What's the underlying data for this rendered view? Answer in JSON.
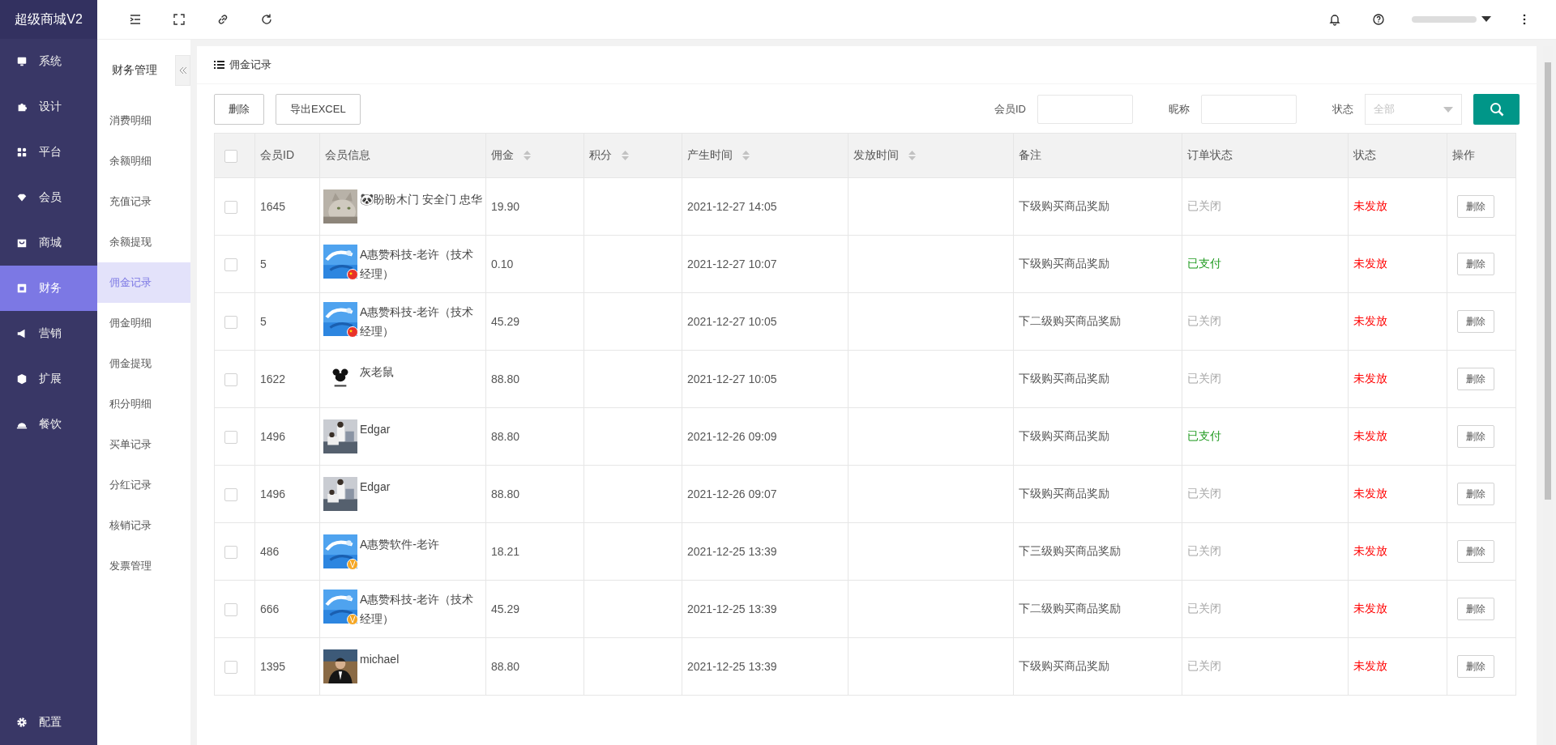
{
  "app": {
    "title": "超级商城V2"
  },
  "nav": [
    {
      "label": "系统",
      "selected": false
    },
    {
      "label": "设计",
      "selected": false
    },
    {
      "label": "平台",
      "selected": false
    },
    {
      "label": "会员",
      "selected": false
    },
    {
      "label": "商城",
      "selected": false
    },
    {
      "label": "财务",
      "selected": true
    },
    {
      "label": "营销",
      "selected": false
    },
    {
      "label": "扩展",
      "selected": false
    },
    {
      "label": "餐饮",
      "selected": false
    }
  ],
  "nav_bottom": {
    "label": "配置"
  },
  "subnav": {
    "title": "财务管理",
    "items": [
      {
        "label": "消费明细",
        "selected": false
      },
      {
        "label": "余额明细",
        "selected": false
      },
      {
        "label": "充值记录",
        "selected": false
      },
      {
        "label": "余额提现",
        "selected": false
      },
      {
        "label": "佣金记录",
        "selected": true
      },
      {
        "label": "佣金明细",
        "selected": false
      },
      {
        "label": "佣金提现",
        "selected": false
      },
      {
        "label": "积分明细",
        "selected": false
      },
      {
        "label": "买单记录",
        "selected": false
      },
      {
        "label": "分红记录",
        "selected": false
      },
      {
        "label": "核销记录",
        "selected": false
      },
      {
        "label": "发票管理",
        "selected": false
      }
    ]
  },
  "card": {
    "title": "佣金记录"
  },
  "toolbar": {
    "buttons": [
      "删除",
      "导出EXCEL"
    ],
    "filters": [
      {
        "label": "会员ID",
        "kind": "input"
      },
      {
        "label": "昵称",
        "kind": "input"
      },
      {
        "label": "状态",
        "kind": "select",
        "value": "全部"
      }
    ]
  },
  "table": {
    "all_checked": false,
    "columns": [
      {
        "label": "会员ID",
        "sortable": false
      },
      {
        "label": "会员信息",
        "sortable": false
      },
      {
        "label": "佣金",
        "sortable": true
      },
      {
        "label": "积分",
        "sortable": true
      },
      {
        "label": "产生时间",
        "sortable": true
      },
      {
        "label": "发放时间",
        "sortable": true
      },
      {
        "label": "备注",
        "sortable": false
      },
      {
        "label": "订单状态",
        "sortable": false
      },
      {
        "label": "状态",
        "sortable": false
      },
      {
        "label": "操作",
        "sortable": false
      }
    ],
    "rows": [
      {
        "checked": false,
        "member_id": "1645",
        "emoji": "🐼",
        "name": "盼盼木门 安全门 忠华",
        "commission": "19.90",
        "created": "2021-12-27 14:05",
        "remark": "下级购买商品奖励",
        "order_status": {
          "text": "已关闭",
          "kind": "closed"
        },
        "status": "未发放",
        "action": "删除"
      },
      {
        "checked": false,
        "member_id": "5",
        "avatar": {
          "kind": "picture",
          "badge": {
            "kind": "flag"
          }
        },
        "name": "A惠赞科技-老许（技术经理）",
        "commission": "0.10",
        "created": "2021-12-27 10:07",
        "remark": "下级购买商品奖励",
        "order_status": {
          "text": "已支付",
          "kind": "paid"
        },
        "status": "未发放",
        "action": "删除"
      },
      {
        "checked": false,
        "member_id": "5",
        "avatar": {
          "kind": "picture",
          "badge": {
            "kind": "flag"
          }
        },
        "name": "A惠赞科技-老许（技术经理）",
        "commission": "45.29",
        "created": "2021-12-27 10:05",
        "remark": "下二级购买商品奖励",
        "order_status": {
          "text": "已关闭",
          "kind": "closed"
        },
        "status": "未发放",
        "action": "删除"
      },
      {
        "checked": false,
        "member_id": "1622",
        "name": "灰老鼠",
        "commission": "88.80",
        "created": "2021-12-27 10:05",
        "remark": "下级购买商品奖励",
        "order_status": {
          "text": "已关闭",
          "kind": "closed"
        },
        "status": "未发放",
        "action": "删除"
      },
      {
        "checked": false,
        "member_id": "1496",
        "name": "Edgar",
        "commission": "88.80",
        "created": "2021-12-26 09:09",
        "remark": "下级购买商品奖励",
        "order_status": {
          "text": "已支付",
          "kind": "paid"
        },
        "status": "未发放",
        "action": "删除"
      },
      {
        "checked": false,
        "member_id": "1496",
        "name": "Edgar",
        "commission": "88.80",
        "created": "2021-12-26 09:07",
        "remark": "下级购买商品奖励",
        "order_status": {
          "text": "已关闭",
          "kind": "closed"
        },
        "status": "未发放",
        "action": "删除"
      },
      {
        "checked": false,
        "member_id": "486",
        "avatar": {
          "kind": "picture",
          "badge": {
            "kind": "vip",
            "text": "V"
          }
        },
        "name": "A惠赞软件-老许",
        "commission": "18.21",
        "created": "2021-12-25 13:39",
        "remark": "下三级购买商品奖励",
        "order_status": {
          "text": "已关闭",
          "kind": "closed"
        },
        "status": "未发放",
        "action": "删除"
      },
      {
        "checked": false,
        "member_id": "666",
        "avatar": {
          "kind": "picture",
          "badge": {
            "kind": "vip",
            "text": "V"
          }
        },
        "name": "A惠赞科技-老许（技术经理）",
        "commission": "45.29",
        "created": "2021-12-25 13:39",
        "remark": "下二级购买商品奖励",
        "order_status": {
          "text": "已关闭",
          "kind": "closed"
        },
        "status": "未发放",
        "action": "删除"
      },
      {
        "checked": false,
        "member_id": "1395",
        "name": "michael",
        "commission": "88.80",
        "created": "2021-12-25 13:39",
        "remark": "下级购买商品奖励",
        "order_status": {
          "text": "已关闭",
          "kind": "closed"
        },
        "status": "未发放",
        "action": "删除"
      }
    ]
  }
}
